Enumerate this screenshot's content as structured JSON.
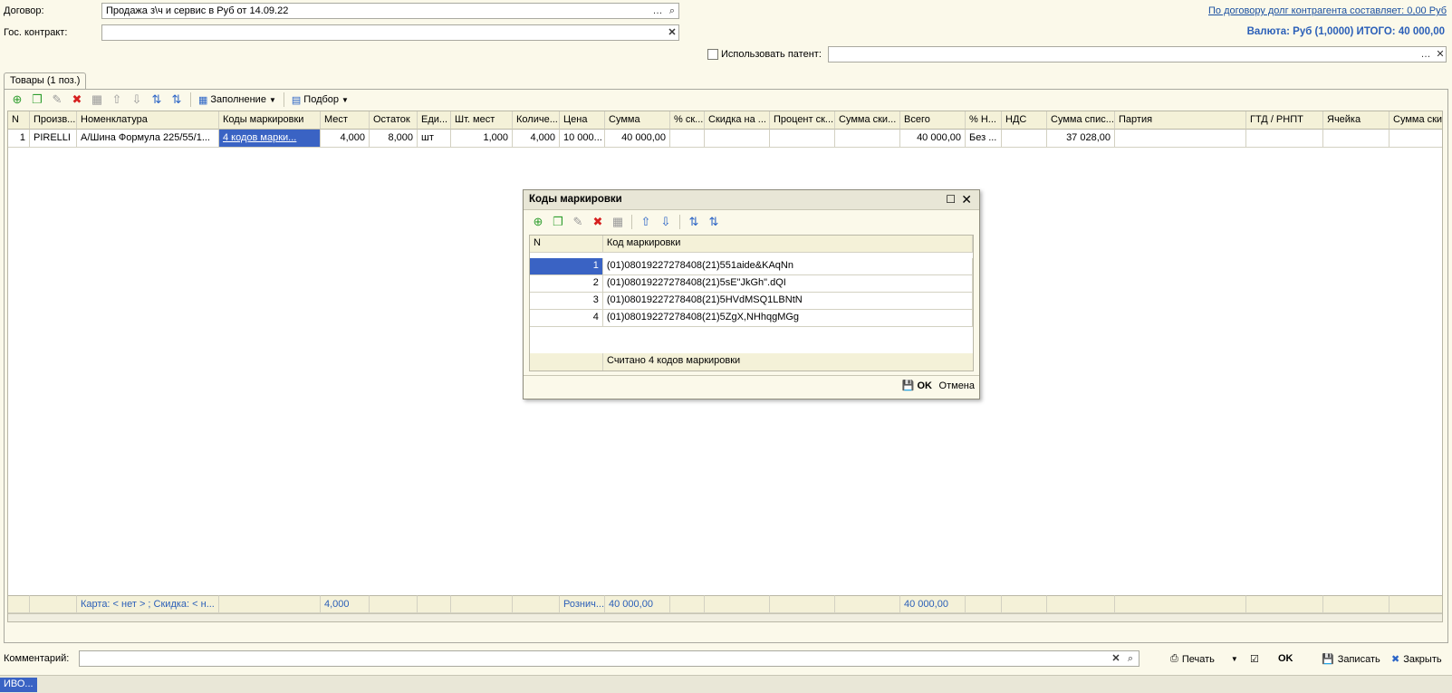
{
  "header": {
    "contract_label": "Договор:",
    "contract_value": "Продажа з\\ч и сервис в Руб от 14.09.22",
    "gos_label": "Гос. контракт:",
    "gos_value": "",
    "debt_link": "По договору долг контрагента составляет: 0,00 Руб",
    "currency_total": "Валюта: Руб (1,0000) ИТОГО: 40 000,00",
    "patent_label": "Использовать патент:",
    "patent_value": ""
  },
  "tabs": [
    {
      "label": "Товары (1 поз.)"
    }
  ],
  "toolbar": {
    "fill_label": "Заполнение",
    "pick_label": "Подбор"
  },
  "table": {
    "columns": [
      "N",
      "Произв...",
      "Номенклатура",
      "Коды маркировки",
      "Мест",
      "Остаток",
      "Еди...",
      "Шт. мест",
      "Количе...",
      "Цена",
      "Сумма",
      "% ск...",
      "Скидка на ...",
      "Процент ск...",
      "Сумма ски...",
      "Всего",
      "% Н...",
      "НДС",
      "Сумма спис...",
      "Партия",
      "ГТД / РНПТ",
      "Ячейка",
      "Сумма ски..."
    ],
    "rows": [
      [
        "1",
        "PIRELLI",
        "А/Шина Формула 225/55/1...",
        "4 кодов марки...",
        "4,000",
        "8,000",
        "шт",
        "1,000",
        "4,000",
        "10 000...",
        "40 000,00",
        "",
        "",
        "",
        "",
        "40 000,00",
        "Без ...",
        "",
        "37 028,00",
        "",
        "",
        "",
        ""
      ]
    ],
    "footer": [
      "",
      "",
      "Карта: < нет > ; Скидка: < н...",
      "",
      "4,000",
      "",
      "",
      "",
      "",
      "Рознич...",
      "40 000,00",
      "",
      "",
      "",
      "",
      "40 000,00",
      "",
      "",
      "",
      "",
      "",
      "",
      ""
    ]
  },
  "dialog": {
    "title": "Коды маркировки",
    "columns": [
      "N",
      "Код маркировки"
    ],
    "rows": [
      [
        "1",
        "(01)08019227278408(21)551aide&KAqNn"
      ],
      [
        "2",
        "(01)08019227278408(21)5sE\"JkGh\".dQI"
      ],
      [
        "3",
        "(01)08019227278408(21)5HVdMSQ1LBNtN"
      ],
      [
        "4",
        "(01)08019227278408(21)5ZgX,NHhqgMGg"
      ]
    ],
    "summary": "Считано 4 кодов маркировки",
    "ok_label": "OK",
    "cancel_label": "Отмена"
  },
  "bottom": {
    "comment_label": "Комментарий:",
    "comment_value": "",
    "print_label": "Печать",
    "ok_label": "OK",
    "save_label": "Записать",
    "close_label": "Закрыть"
  },
  "statusbar": {
    "item": "ИВО..."
  }
}
